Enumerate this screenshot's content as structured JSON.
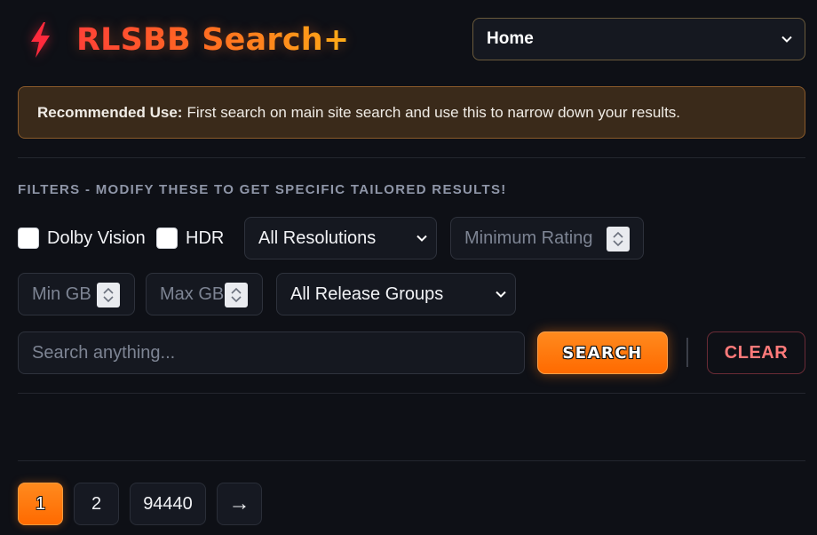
{
  "app": {
    "title": "RLSBB Search+"
  },
  "nav": {
    "selected": "Home"
  },
  "notice": {
    "label": "Recommended Use:",
    "text": "First search on main site search and use this to narrow down your results."
  },
  "filters": {
    "heading": "FILTERS - MODIFY THESE TO GET SPECIFIC TAILORED RESULTS!",
    "dolby_vision": {
      "label": "Dolby Vision",
      "checked": false
    },
    "hdr": {
      "label": "HDR",
      "checked": false
    },
    "resolution": {
      "selected": "All Resolutions"
    },
    "min_rating": {
      "placeholder": "Minimum Rating"
    },
    "min_gb": {
      "placeholder": "Min GB"
    },
    "max_gb": {
      "placeholder": "Max GB"
    },
    "release_groups": {
      "selected": "All Release Groups"
    }
  },
  "search": {
    "placeholder": "Search anything...",
    "button_label": "SEARCH",
    "clear_label": "CLEAR"
  },
  "pagination": {
    "pages": [
      "1",
      "2",
      "94440"
    ],
    "current": "1",
    "next_label": "→"
  },
  "colors": {
    "accent": "#ff7a00",
    "background": "#0e1016",
    "notice_bg": "#3a2a1a",
    "clear_text": "#ff7a7a"
  }
}
